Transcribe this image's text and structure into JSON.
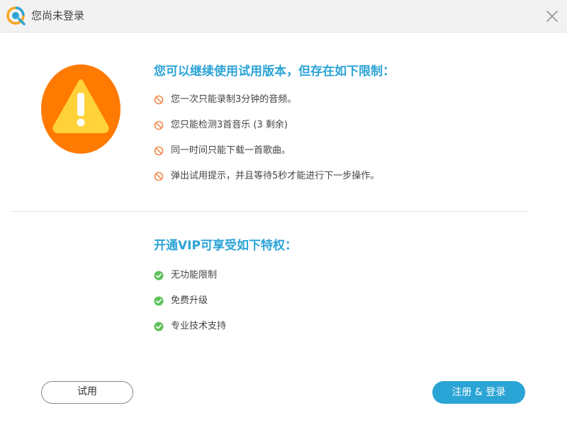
{
  "window": {
    "title": "您尚未登录",
    "logo_icon": "app-logo-icon",
    "close_icon": "close-icon"
  },
  "limits": {
    "heading": "您可以继续使用试用版本，但存在如下限制：",
    "icon": "prohibited-icon",
    "items": [
      {
        "label": "您一次只能录制3分钟的音频。"
      },
      {
        "label": "您只能检测3首音乐 (3 剩余)"
      },
      {
        "label": "同一时间只能下载一首歌曲。"
      },
      {
        "label": "弹出试用提示，并且等待5秒才能进行下一步操作。"
      }
    ]
  },
  "vip": {
    "heading": "开通VIP可享受如下特权：",
    "icon": "check-circle-icon",
    "items": [
      {
        "label": "无功能限制"
      },
      {
        "label": "免费升级"
      },
      {
        "label": "专业技术支持"
      }
    ]
  },
  "buttons": {
    "trial": "试用",
    "register_login": "注册 & 登录"
  },
  "colors": {
    "accent_blue": "#2ba3d6",
    "warning_orange": "#ff7a00",
    "warning_yellow": "#ffd23a",
    "prohibit_orange": "#f08a4b",
    "check_green": "#5cc25a"
  }
}
